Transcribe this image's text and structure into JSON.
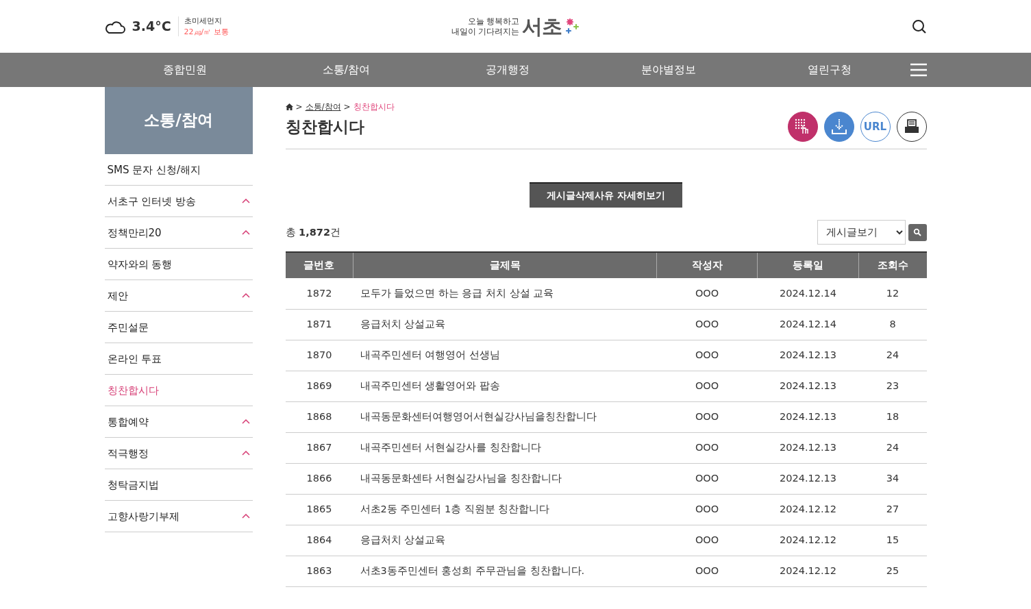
{
  "header": {
    "weather": {
      "temperature": "3.4°C",
      "dust_label": "초미세먼지",
      "dust_value": "22㎍/㎥ 보통"
    },
    "logo": {
      "slogan_line1": "오늘 행복하고",
      "slogan_line2": "내일이 기다려지는",
      "name": "서초"
    }
  },
  "nav": [
    "종합민원",
    "소통/참여",
    "공개행정",
    "분야별정보",
    "열린구청"
  ],
  "sidebar": {
    "title": "소통/참여",
    "items": [
      {
        "label": "SMS 문자 신청/해지",
        "expandable": false,
        "selected": false
      },
      {
        "label": "서초구 인터넷 방송",
        "expandable": true,
        "selected": false
      },
      {
        "label": "정책만리20",
        "expandable": true,
        "selected": false
      },
      {
        "label": "약자와의 동행",
        "expandable": false,
        "selected": false
      },
      {
        "label": "제안",
        "expandable": true,
        "selected": false
      },
      {
        "label": "주민설문",
        "expandable": false,
        "selected": false
      },
      {
        "label": "온라인 투표",
        "expandable": false,
        "selected": false
      },
      {
        "label": "칭찬합시다",
        "expandable": false,
        "selected": true
      },
      {
        "label": "통합예약",
        "expandable": true,
        "selected": false
      },
      {
        "label": "적극행정",
        "expandable": true,
        "selected": false
      },
      {
        "label": "청탁금지법",
        "expandable": false,
        "selected": false
      },
      {
        "label": "고향사랑기부제",
        "expandable": true,
        "selected": false
      }
    ]
  },
  "breadcrumb": {
    "separator": ">",
    "parent": "소통/참여",
    "current": "칭찬합시다"
  },
  "page_title": "칭찬합시다",
  "url_button": "URL",
  "notice_button": "게시글삭제사유 자세히보기",
  "total": "총 **1,872**건",
  "filter_select": "게시글보기",
  "table": {
    "columns": [
      "글번호",
      "글제목",
      "작성자",
      "등록일",
      "조회수"
    ],
    "rows": [
      [
        "1872",
        "모두가 들었으면 하는 응급 처치 상설 교육",
        "OOO",
        "2024.12.14",
        "12"
      ],
      [
        "1871",
        "응급처치 상설교육",
        "OOO",
        "2024.12.14",
        "8"
      ],
      [
        "1870",
        "내곡주민센터 여행영어 선생님",
        "OOO",
        "2024.12.13",
        "24"
      ],
      [
        "1869",
        "내곡주민센터 생활영어와 팝송",
        "OOO",
        "2024.12.13",
        "23"
      ],
      [
        "1868",
        "내곡동문화센터여행영어서현실강사님을칭찬합니다",
        "OOO",
        "2024.12.13",
        "18"
      ],
      [
        "1867",
        "내곡주민센터 서현실강사를 칭찬합니다",
        "OOO",
        "2024.12.13",
        "24"
      ],
      [
        "1866",
        "내곡동문화센타 서현실강사님을 칭찬합니다",
        "OOO",
        "2024.12.13",
        "34"
      ],
      [
        "1865",
        "서초2동 주민센터 1층 직원분 칭찬합니다",
        "OOO",
        "2024.12.12",
        "27"
      ],
      [
        "1864",
        "응급처치 상설교육",
        "OOO",
        "2024.12.12",
        "15"
      ],
      [
        "1863",
        "서초3동주민센터 홍성희 주무관님을 칭찬합니다.",
        "OOO",
        "2024.12.12",
        "25"
      ]
    ]
  }
}
